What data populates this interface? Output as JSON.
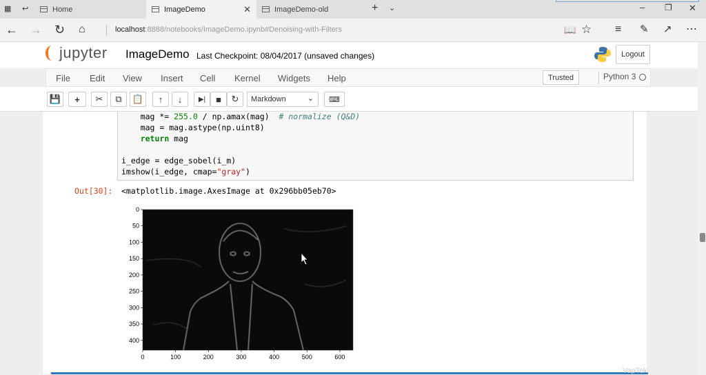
{
  "browser": {
    "tabs": [
      {
        "label": "Home"
      },
      {
        "label": "ImageDemo"
      },
      {
        "label": "ImageDemo-old"
      }
    ],
    "url_host": "localhost",
    "url_path": ":8888/notebooks/ImageDemo.ipynb#Denoising-with-Filters"
  },
  "jupyter": {
    "logo_text": "jupyter",
    "notebook_title": "ImageDemo",
    "checkpoint": "Last Checkpoint: 08/04/2017 (unsaved changes)",
    "logout_label": "Logout",
    "menu": [
      "File",
      "Edit",
      "View",
      "Insert",
      "Cell",
      "Kernel",
      "Widgets",
      "Help"
    ],
    "trusted_label": "Trusted",
    "kernel_name": "Python 3",
    "cell_type": "Markdown"
  },
  "cell": {
    "code_lines": [
      [
        "    mag *= ",
        "255.0",
        " / np.amax(mag)  ",
        "# normalize (Q&D)"
      ],
      [
        "    mag = mag.astype(np.uint8)"
      ],
      [
        "    ",
        "return",
        " mag"
      ],
      [
        ""
      ],
      [
        "i_edge = edge_sobel(i_m)"
      ],
      [
        "imshow(i_edge, cmap=",
        "\"gray\"",
        ")"
      ]
    ],
    "out_prompt": "Out[30]:",
    "out_text": "<matplotlib.image.AxesImage at 0x296bb05eb70>"
  },
  "chart_data": {
    "type": "heatmap",
    "colormap": "gray",
    "x_ticks": [
      "0",
      "100",
      "200",
      "300",
      "400",
      "500",
      "600"
    ],
    "y_ticks": [
      "0",
      "50",
      "100",
      "150",
      "200",
      "250",
      "300",
      "350",
      "400"
    ],
    "xlim": [
      0,
      640
    ],
    "ylim": [
      0,
      430
    ]
  },
  "watermark": "VapTek"
}
